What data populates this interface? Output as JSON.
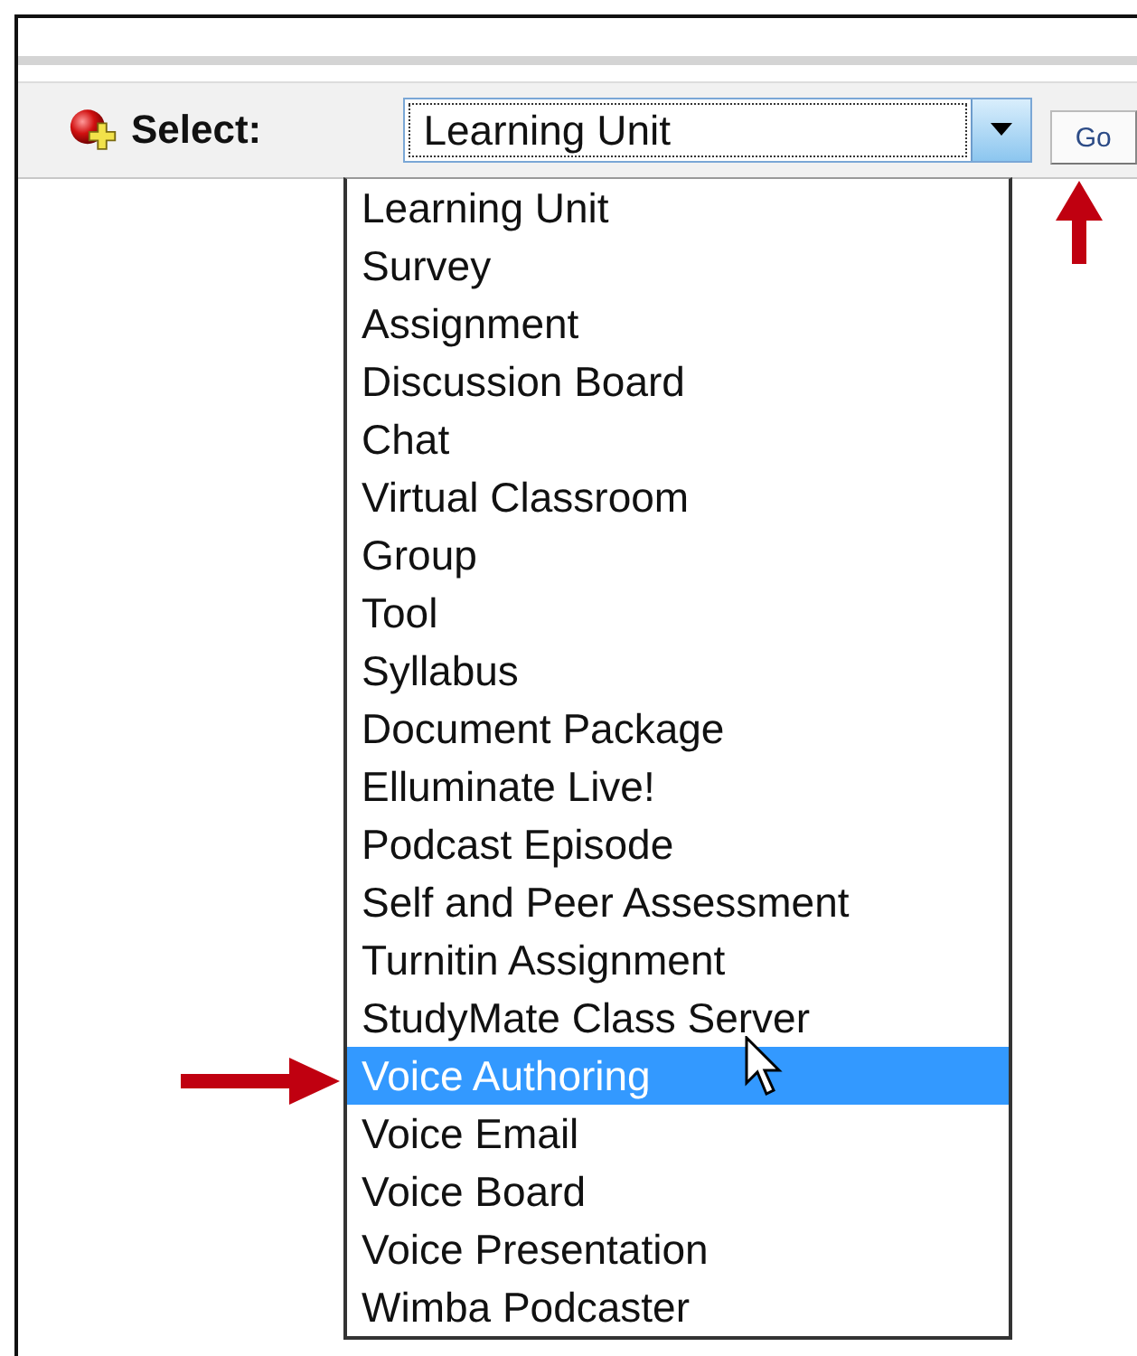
{
  "toolbar": {
    "label": "Select:",
    "select": {
      "value": "Learning Unit",
      "expanded": true
    },
    "go_button": "Go"
  },
  "dropdown": {
    "items": [
      {
        "label": "Learning Unit",
        "selected": false
      },
      {
        "label": "Survey",
        "selected": false
      },
      {
        "label": "Assignment",
        "selected": false
      },
      {
        "label": "Discussion Board",
        "selected": false
      },
      {
        "label": "Chat",
        "selected": false
      },
      {
        "label": "Virtual Classroom",
        "selected": false
      },
      {
        "label": "Group",
        "selected": false
      },
      {
        "label": "Tool",
        "selected": false
      },
      {
        "label": "Syllabus",
        "selected": false
      },
      {
        "label": "Document Package",
        "selected": false
      },
      {
        "label": "Elluminate Live!",
        "selected": false
      },
      {
        "label": "Podcast Episode",
        "selected": false
      },
      {
        "label": "Self and Peer Assessment",
        "selected": false
      },
      {
        "label": "Turnitin Assignment",
        "selected": false
      },
      {
        "label": "StudyMate Class Server",
        "selected": false
      },
      {
        "label": "Voice Authoring",
        "selected": true
      },
      {
        "label": "Voice Email",
        "selected": false
      },
      {
        "label": "Voice Board",
        "selected": false
      },
      {
        "label": "Voice Presentation",
        "selected": false
      },
      {
        "label": "Wimba Podcaster",
        "selected": false
      }
    ]
  }
}
